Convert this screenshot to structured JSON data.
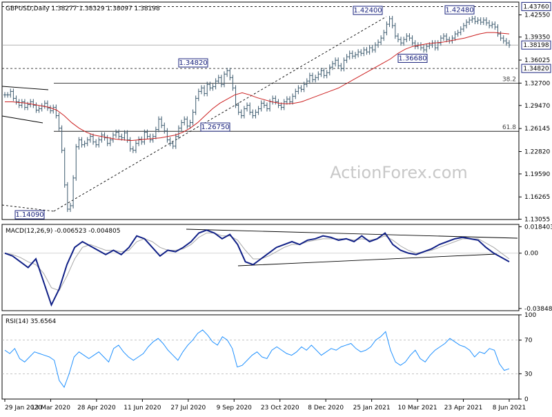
{
  "chart_data": [
    {
      "type": "line",
      "panel": "price",
      "title": "GBPUSD,Daily",
      "ohlc_text": "1.38277 1.38329 1.38097 1.38198",
      "ylim": [
        1.13,
        1.444
      ],
      "y_ticks": [
        1.4255,
        1.3935,
        1.36025,
        1.327,
        1.2947,
        1.26145,
        1.2282,
        1.1959,
        1.16265,
        1.13055
      ],
      "y_tick_labels": [
        "1.42550",
        "1.39350",
        "1.36025",
        "1.32700",
        "1.29470",
        "1.26145",
        "1.22820",
        "1.19590",
        "1.16265",
        "1.13055"
      ],
      "highlight_labels": [
        {
          "text": "1.43760",
          "value": 1.4376
        },
        {
          "text": "1.38198",
          "value": 1.38198
        },
        {
          "text": "1.34820",
          "value": 1.3482
        }
      ],
      "x_labels": [
        "29 Jan 2020",
        "13 Mar 2020",
        "28 Apr 2020",
        "11 Jun 2020",
        "27 Jul 2020",
        "9 Sep 2020",
        "23 Oct 2020",
        "8 Dec 2020",
        "25 Jan 2021",
        "10 Mar 2021",
        "23 Apr 2021",
        "8 Jun 2021"
      ],
      "series": [
        {
          "type": "ohlc",
          "color": "#3c5a6e",
          "values": [
            1.31,
            1.31,
            1.315,
            1.305,
            1.3,
            1.295,
            1.3,
            1.292,
            1.296,
            1.3,
            1.295,
            1.288,
            1.29,
            1.294,
            1.298,
            1.291,
            1.287,
            1.292,
            1.28,
            1.262,
            1.23,
            1.18,
            1.145,
            1.15,
            1.19,
            1.235,
            1.245,
            1.238,
            1.24,
            1.245,
            1.25,
            1.242,
            1.238,
            1.245,
            1.252,
            1.248,
            1.24,
            1.245,
            1.252,
            1.256,
            1.25,
            1.248,
            1.255,
            1.245,
            1.232,
            1.23,
            1.24,
            1.246,
            1.242,
            1.256,
            1.25,
            1.245,
            1.25,
            1.26,
            1.275,
            1.266,
            1.258,
            1.245,
            1.24,
            1.236,
            1.25,
            1.262,
            1.27,
            1.275,
            1.265,
            1.27,
            1.285,
            1.305,
            1.315,
            1.32,
            1.312,
            1.325,
            1.32,
            1.322,
            1.33,
            1.335,
            1.325,
            1.34,
            1.345,
            1.335,
            1.32,
            1.295,
            1.285,
            1.28,
            1.29,
            1.295,
            1.285,
            1.28,
            1.285,
            1.29,
            1.298,
            1.295,
            1.29,
            1.3,
            1.305,
            1.3,
            1.295,
            1.292,
            1.3,
            1.304,
            1.3,
            1.308,
            1.315,
            1.32,
            1.318,
            1.325,
            1.33,
            1.338,
            1.332,
            1.335,
            1.34,
            1.345,
            1.338,
            1.342,
            1.35,
            1.355,
            1.36,
            1.352,
            1.348,
            1.36,
            1.365,
            1.37,
            1.366,
            1.368,
            1.372,
            1.37,
            1.375,
            1.372,
            1.378,
            1.375,
            1.382,
            1.386,
            1.392,
            1.4,
            1.412,
            1.42,
            1.41,
            1.395,
            1.39,
            1.385,
            1.39,
            1.395,
            1.392,
            1.385,
            1.38,
            1.382,
            1.378,
            1.375,
            1.38,
            1.382,
            1.385,
            1.378,
            1.385,
            1.392,
            1.395,
            1.39,
            1.388,
            1.392,
            1.398,
            1.4,
            1.405,
            1.41,
            1.415,
            1.418,
            1.42,
            1.416,
            1.418,
            1.415,
            1.418,
            1.414,
            1.41,
            1.412,
            1.408,
            1.398,
            1.392,
            1.388,
            1.385,
            1.382
          ]
        },
        {
          "type": "line",
          "label_text": "",
          "color": "#cc1f1f",
          "values": [
            1.3,
            1.3,
            1.299,
            1.298,
            1.296,
            1.294,
            1.292,
            1.288,
            1.28,
            1.27,
            1.262,
            1.256,
            1.252,
            1.25,
            1.248,
            1.246,
            1.245,
            1.244,
            1.245,
            1.246,
            1.247,
            1.248,
            1.25,
            1.252,
            1.256,
            1.262,
            1.27,
            1.28,
            1.29,
            1.298,
            1.304,
            1.31,
            1.313,
            1.31,
            1.306,
            1.303,
            1.3,
            1.298,
            1.297,
            1.298,
            1.3,
            1.304,
            1.308,
            1.312,
            1.316,
            1.32,
            1.326,
            1.332,
            1.338,
            1.344,
            1.35,
            1.356,
            1.362,
            1.37,
            1.376,
            1.38,
            1.382,
            1.384,
            1.385,
            1.386,
            1.388,
            1.39,
            1.392,
            1.395,
            1.398,
            1.4,
            1.4,
            1.399,
            1.398
          ]
        }
      ],
      "level_lines": [
        {
          "value": 1.4376,
          "style": "dashed",
          "label": ""
        },
        {
          "value": 1.3482,
          "style": "dashed",
          "label": ""
        },
        {
          "value": 1.38198,
          "style": "solid-grey",
          "label": ""
        },
        {
          "value": 1.327,
          "style": "solid",
          "label": "38.2"
        },
        {
          "value": 1.2574,
          "style": "solid",
          "label": "61.8"
        }
      ],
      "annotations": [
        {
          "text": "1.42400",
          "value": 1.424
        },
        {
          "text": "1.42480",
          "value": 1.4248
        },
        {
          "text": "1.34820",
          "value": 1.3482
        },
        {
          "text": "1.36680",
          "value": 1.3668
        },
        {
          "text": "1.26750",
          "value": 1.2675
        },
        {
          "text": "1.14090",
          "value": 1.1409
        }
      ]
    },
    {
      "type": "line",
      "panel": "macd",
      "title": "MACD(12,26,9) -0.006523 -0.004805",
      "ylim": [
        -0.04,
        0.02
      ],
      "y_ticks": [
        0.018403,
        0.0,
        -0.038483
      ],
      "y_tick_labels": [
        "0.018403",
        "0.00",
        "-0.038483"
      ],
      "series": [
        {
          "label_text": "",
          "color": "#0f1f86",
          "values": [
            0.0,
            -0.002,
            -0.006,
            -0.01,
            -0.004,
            -0.02,
            -0.036,
            -0.025,
            -0.008,
            0.004,
            0.008,
            0.005,
            0.002,
            -0.001,
            0.002,
            -0.001,
            0.004,
            0.012,
            0.01,
            0.004,
            -0.002,
            0.002,
            0.001,
            0.004,
            0.008,
            0.014,
            0.016,
            0.014,
            0.01,
            0.013,
            0.006,
            -0.006,
            -0.008,
            -0.004,
            0.0,
            0.004,
            0.006,
            0.008,
            0.006,
            0.009,
            0.01,
            0.012,
            0.011,
            0.009,
            0.01,
            0.008,
            0.012,
            0.008,
            0.01,
            0.014,
            0.006,
            0.002,
            0.0,
            -0.001,
            0.001,
            0.003,
            0.006,
            0.008,
            0.01,
            0.011,
            0.01,
            0.009,
            0.004,
            0.0,
            -0.003,
            -0.006
          ]
        },
        {
          "label_text": "",
          "color": "#a8a8a8",
          "values": [
            0.0,
            -0.001,
            -0.003,
            -0.006,
            -0.008,
            -0.014,
            -0.024,
            -0.026,
            -0.016,
            -0.004,
            0.004,
            0.006,
            0.004,
            0.002,
            0.002,
            0.001,
            0.002,
            0.008,
            0.01,
            0.008,
            0.004,
            0.002,
            0.002,
            0.003,
            0.006,
            0.011,
            0.014,
            0.014,
            0.012,
            0.012,
            0.009,
            0.002,
            -0.004,
            -0.004,
            -0.002,
            0.001,
            0.004,
            0.006,
            0.006,
            0.008,
            0.009,
            0.01,
            0.01,
            0.01,
            0.01,
            0.009,
            0.01,
            0.009,
            0.01,
            0.012,
            0.009,
            0.005,
            0.002,
            0.0,
            0.001,
            0.002,
            0.004,
            0.006,
            0.008,
            0.01,
            0.01,
            0.01,
            0.007,
            0.004,
            0.0,
            -0.004
          ]
        }
      ]
    },
    {
      "type": "line",
      "panel": "rsi",
      "title": "RSI(14) 35.6564",
      "ylim": [
        0,
        100
      ],
      "y_ticks": [
        100,
        70,
        30,
        0
      ],
      "y_tick_labels": [
        "100",
        "70",
        "30",
        "0"
      ],
      "levels": [
        70,
        30
      ],
      "series": [
        {
          "label_text": "",
          "color": "#1e90ff",
          "values": [
            58,
            54,
            60,
            48,
            44,
            50,
            56,
            54,
            52,
            50,
            46,
            22,
            14,
            30,
            50,
            56,
            52,
            48,
            52,
            56,
            50,
            44,
            60,
            64,
            56,
            50,
            46,
            50,
            54,
            62,
            68,
            72,
            66,
            58,
            52,
            46,
            56,
            64,
            70,
            78,
            82,
            76,
            68,
            64,
            74,
            70,
            60,
            38,
            40,
            46,
            52,
            56,
            50,
            48,
            58,
            62,
            58,
            54,
            52,
            56,
            62,
            58,
            64,
            58,
            52,
            56,
            60,
            58,
            62,
            64,
            66,
            60,
            56,
            58,
            62,
            70,
            74,
            80,
            58,
            44,
            40,
            44,
            52,
            58,
            48,
            44,
            52,
            58,
            62,
            66,
            72,
            68,
            64,
            62,
            58,
            50,
            56,
            54,
            60,
            58,
            42,
            34,
            36
          ]
        }
      ]
    }
  ],
  "watermark": "ActionForex.com"
}
